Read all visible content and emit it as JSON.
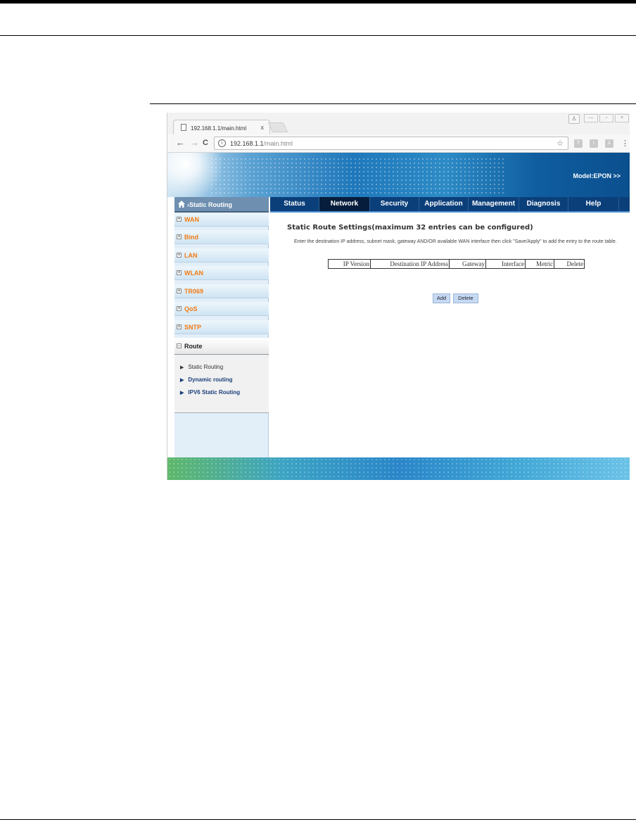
{
  "browser": {
    "tab_title": "192.168.1.1/main.html",
    "tab_close": "x",
    "url_host": "192.168.1.1",
    "url_path": "/main.html",
    "nav": {
      "back": "←",
      "forward": "→",
      "reload": "C"
    },
    "info_icon": "i",
    "star": "☆",
    "menu": "⋮"
  },
  "router": {
    "model": "Model:EPON >>",
    "breadcrumb": "›Static Routing",
    "top_nav": [
      "Status",
      "Network",
      "Security",
      "Application",
      "Management",
      "Diagnosis",
      "Help"
    ],
    "active_nav": "Network",
    "sidebar": {
      "items": [
        "WAN",
        "Bind",
        "LAN",
        "WLAN",
        "TR069",
        "QoS",
        "SNTP",
        "Route"
      ],
      "open_item": "Route",
      "sub_items": [
        "Static Routing",
        "Dynamic routing",
        "IPV6 Static Routing"
      ],
      "current_sub": "Static Routing"
    },
    "content": {
      "title": "Static Route Settings(maximum 32 entries can be configured)",
      "description": "Enter the destination IP address, subnet mask, gateway AND/OR available WAN interface then click \"Save/Apply\" to add the entry to the route table.",
      "table_headers": [
        "IP Version",
        "Destination IP Address",
        "Gateway",
        "Interface",
        "Metric",
        "Delete"
      ],
      "add_button": "Add",
      "delete_button": "Delete"
    }
  },
  "colors": {
    "nav_bar": "#0b3f7a",
    "nav_active": "#061d3c",
    "sidebar_label": "#f07c14",
    "sub_link": "#1b3f7a",
    "button": "#c6daf2"
  }
}
